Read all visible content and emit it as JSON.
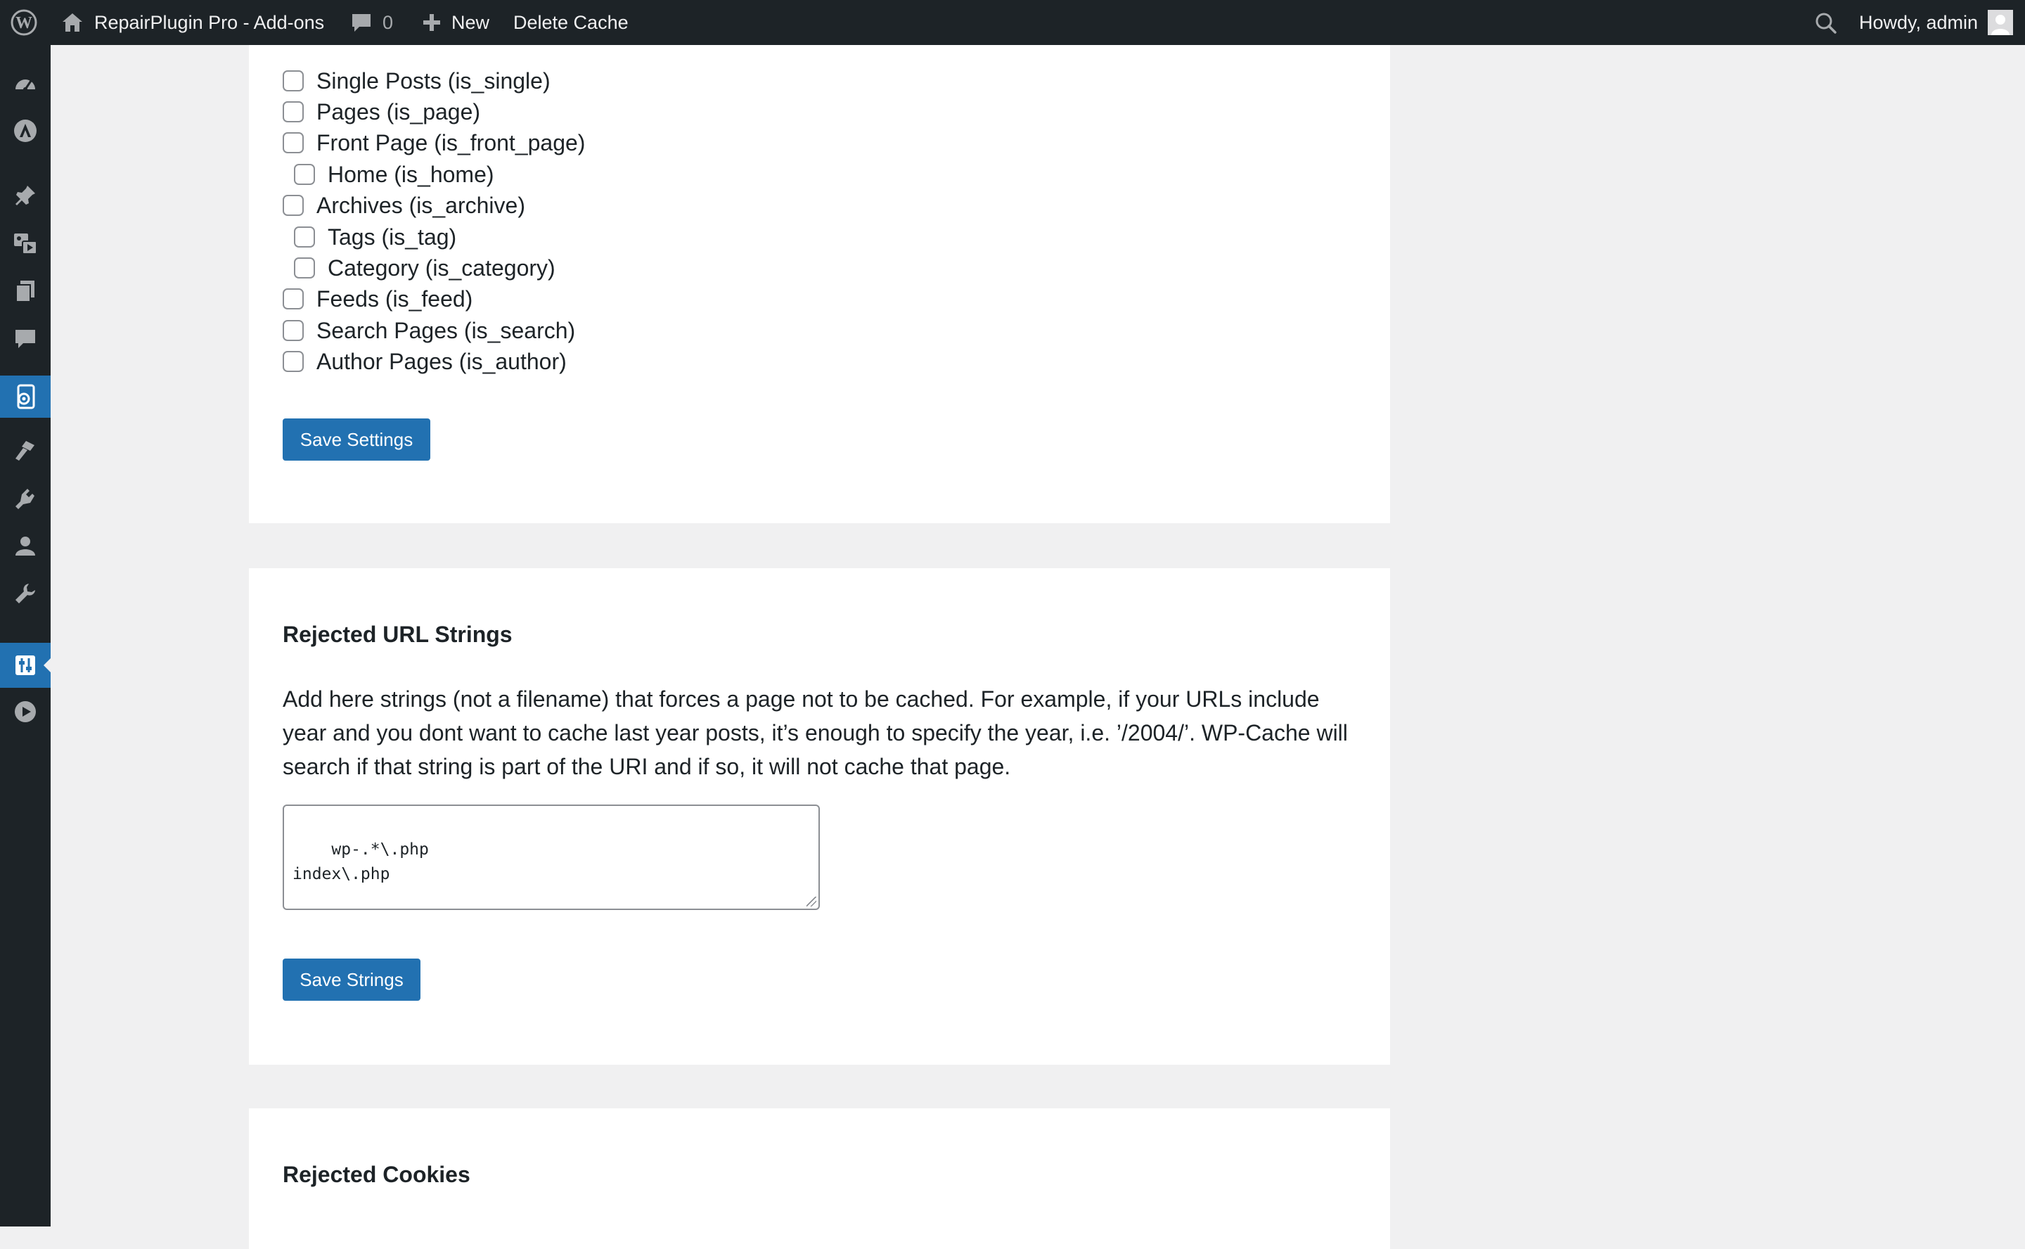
{
  "admin_bar": {
    "site_name": "RepairPlugin Pro - Add-ons",
    "comments_count": "0",
    "new_label": "New",
    "delete_cache_label": "Delete Cache",
    "greeting": "Howdy, admin"
  },
  "admin_menu": {
    "icons": [
      "dashboard-icon",
      "astra-icon",
      "pin-icon",
      "media-icon",
      "pages-icon",
      "comments-icon",
      "repairplugin-icon",
      "appearance-icon",
      "plugins-icon",
      "users-icon",
      "tools-icon",
      "settings-icon",
      "play-icon"
    ],
    "active": "settings-icon"
  },
  "conditions_section": {
    "options": [
      {
        "label": "Single Posts (is_single)",
        "checked": false
      },
      {
        "label": "Pages (is_page)",
        "checked": false
      },
      {
        "label": "Front Page (is_front_page)",
        "checked": false
      },
      {
        "label": "Home (is_home)",
        "checked": false
      },
      {
        "label": "Archives (is_archive)",
        "checked": false
      },
      {
        "label": "Tags (is_tag)",
        "checked": false
      },
      {
        "label": "Category (is_category)",
        "checked": false
      },
      {
        "label": "Feeds (is_feed)",
        "checked": false
      },
      {
        "label": "Search Pages (is_search)",
        "checked": false
      },
      {
        "label": "Author Pages (is_author)",
        "checked": false
      }
    ],
    "save_button": "Save Settings"
  },
  "rejected_urls_section": {
    "title": "Rejected URL Strings",
    "description": "Add here strings (not a filename) that forces a page not to be cached. For example, if your URLs include year and you dont want to cache last year posts, it’s enough to specify the year, i.e. ’/2004/’. WP-Cache will search if that string is part of the URI and if so, it will not cache that page.",
    "textarea_value": "wp-.*\\.php\nindex\\.php",
    "save_button": "Save Strings"
  },
  "rejected_cookies_section": {
    "title": "Rejected Cookies"
  },
  "colors": {
    "admin_bar_bg": "#1d2327",
    "accent": "#2271b1",
    "page_bg": "#f0f0f1"
  }
}
